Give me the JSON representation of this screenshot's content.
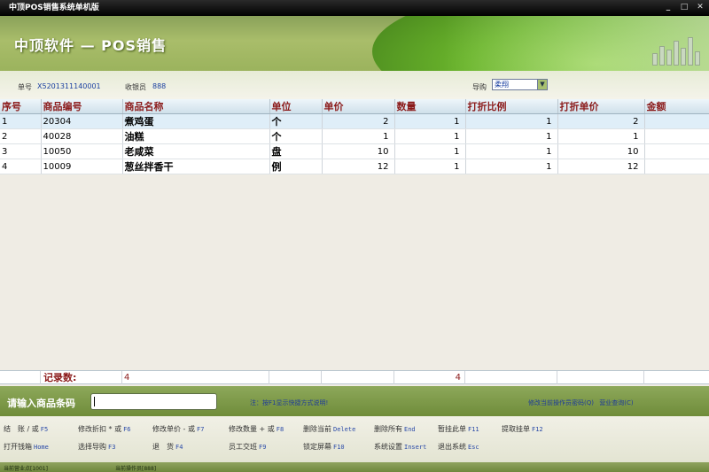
{
  "window": {
    "title": "中顶POS销售系统单机版"
  },
  "header": {
    "brand": "中顶软件 — POS销售"
  },
  "info": {
    "order_label": "单号",
    "order_value": "X5201311140001",
    "cashier_label": "收银员",
    "cashier_value": "888",
    "guide_label": "导购",
    "guide_value": "柔翔"
  },
  "grid": {
    "columns": [
      "序号",
      "商品编号",
      "商品名称",
      "单位",
      "单价",
      "数量",
      "打折比例",
      "打折单价",
      "金额"
    ],
    "rows": [
      {
        "seq": "1",
        "code": "20304",
        "name": "煮鸡蛋",
        "unit": "个",
        "price": "2",
        "qty": "1",
        "disc_rate": "1",
        "disc_price": "2",
        "amount": ""
      },
      {
        "seq": "2",
        "code": "40028",
        "name": "油糕",
        "unit": "个",
        "price": "1",
        "qty": "1",
        "disc_rate": "1",
        "disc_price": "1",
        "amount": ""
      },
      {
        "seq": "3",
        "code": "10050",
        "name": "老咸菜",
        "unit": "盘",
        "price": "10",
        "qty": "1",
        "disc_rate": "1",
        "disc_price": "10",
        "amount": ""
      },
      {
        "seq": "4",
        "code": "10009",
        "name": "葱丝拌香干",
        "unit": "例",
        "price": "12",
        "qty": "1",
        "disc_rate": "1",
        "disc_price": "12",
        "amount": ""
      }
    ],
    "summary": {
      "label": "记录数:",
      "count": "4",
      "qty_total": "4"
    }
  },
  "barcode": {
    "label": "请输入商品条码",
    "value": "",
    "hint": "注：按F1显示快捷方式说明!",
    "link_change_password": "修改当前操作员密码(Q)",
    "link_sales_query": "营业查询(C)"
  },
  "shortcuts": {
    "row1": [
      {
        "label": "结　账 / 或",
        "key": "F5"
      },
      {
        "label": "修改折扣 * 或",
        "key": "F6"
      },
      {
        "label": "修改单价 - 或",
        "key": "F7"
      },
      {
        "label": "修改数量 + 或",
        "key": "F8"
      },
      {
        "label": "删除当前",
        "key": "Delete"
      },
      {
        "label": "删除所有",
        "key": "End"
      },
      {
        "label": "暂挂此单",
        "key": "F11"
      },
      {
        "label": "提取挂单",
        "key": "F12"
      }
    ],
    "row2": [
      {
        "label": "打开钱箱",
        "key": "Home"
      },
      {
        "label": "选择导购",
        "key": "F3"
      },
      {
        "label": "退　货",
        "key": "F4"
      },
      {
        "label": "员工交班",
        "key": "F9"
      },
      {
        "label": "锁定屏幕",
        "key": "F10"
      },
      {
        "label": "系统设置",
        "key": "Insert"
      },
      {
        "label": "退出系统",
        "key": "Esc"
      }
    ]
  },
  "status": {
    "left": "当前营业点[1001]",
    "right": "当前操作员[888]"
  }
}
